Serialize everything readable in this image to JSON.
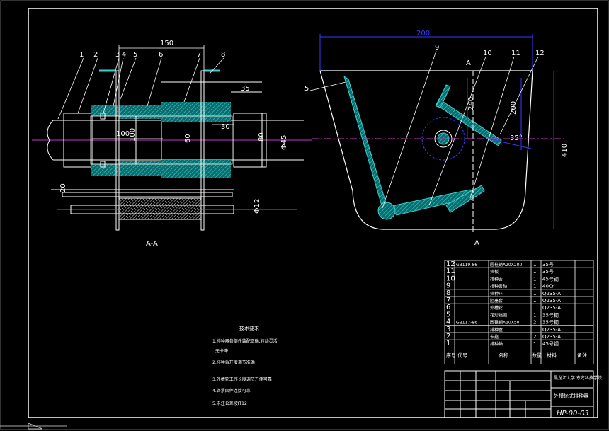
{
  "drawing": {
    "section_label": "A-A",
    "section_marks": [
      "A",
      "A"
    ],
    "drawing_number": "HP-00-03",
    "title": "外槽轮式排种器",
    "school": "黑龙江大学 东方科技学院"
  },
  "left_view": {
    "balloons": [
      "1",
      "2",
      "3",
      "4",
      "5",
      "6",
      "7",
      "8"
    ],
    "dims": {
      "d150": "150",
      "d35": "35",
      "d30": "30",
      "d100": "100",
      "d100v": "100",
      "d80": "80",
      "d60": "60",
      "d20": "20",
      "phi45": "Ф45",
      "phi12": "Ф12"
    }
  },
  "right_view": {
    "balloons": [
      "5",
      "9",
      "10",
      "11",
      "12"
    ],
    "dims": {
      "d200": "200",
      "d410": "410",
      "d240": "240",
      "d200v": "200",
      "d35": "35°"
    }
  },
  "parts_table": {
    "rows": [
      {
        "no": "12",
        "code": "GB119-86",
        "name": "圆柱销A20X200",
        "qty": "1",
        "mat": "35号"
      },
      {
        "no": "11",
        "code": "",
        "name": "挡板",
        "qty": "1",
        "mat": "35号"
      },
      {
        "no": "10",
        "code": "",
        "name": "排种舌",
        "qty": "1",
        "mat": "45号钢"
      },
      {
        "no": "9",
        "code": "",
        "name": "排种舌轴",
        "qty": "1",
        "mat": "40Cr"
      },
      {
        "no": "8",
        "code": "",
        "name": "挡种环",
        "qty": "1",
        "mat": "Q235-A"
      },
      {
        "no": "7",
        "code": "",
        "name": "阻塞套",
        "qty": "1",
        "mat": "Q235-A"
      },
      {
        "no": "6",
        "code": "",
        "name": "外槽轮",
        "qty": "1",
        "mat": "Q235-A"
      },
      {
        "no": "5",
        "code": "",
        "name": "花形挡圈",
        "qty": "1",
        "mat": "35号钢"
      },
      {
        "no": "4",
        "code": "GB117-86",
        "name": "圆锥销A10X50",
        "qty": "2",
        "mat": "35号钢"
      },
      {
        "no": "3",
        "code": "",
        "name": "排种盒",
        "qty": "1",
        "mat": "Q235-A"
      },
      {
        "no": "2",
        "code": "",
        "name": "卡箍",
        "qty": "2",
        "mat": "Q235-A"
      },
      {
        "no": "1",
        "code": "",
        "name": "排种轴",
        "qty": "1",
        "mat": "45号钢"
      }
    ],
    "header": {
      "no": "序号",
      "code": "代号",
      "name": "名称",
      "qty": "数量",
      "mat": "材料",
      "note": "备注"
    }
  },
  "notes": {
    "heading": "技术要求",
    "lines": [
      "1.排种器各部件装配正确,转动灵活",
      "无卡滞",
      "2.排种舌开度调节准确",
      "3.外槽轮工作长度调节方便可靠",
      "4.各紧固件连接可靠",
      "5.未注公差按IT12"
    ]
  },
  "colors": {
    "bg": "#000000",
    "line": "#ffffff",
    "dim": "#3a3aff",
    "center": "#cc33cc",
    "section": "#1aa6a6",
    "frame": "#ffffff"
  }
}
